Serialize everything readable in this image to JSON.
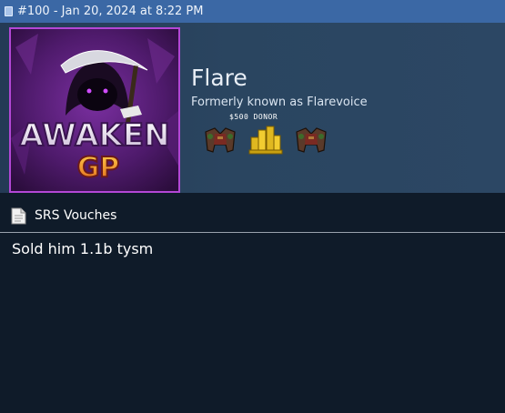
{
  "post": {
    "header": "#100 - Jan 20, 2024 at 8:22 PM"
  },
  "user": {
    "avatar_text_line1": "AWAKEN",
    "avatar_text_line2": "GP",
    "name": "Flare",
    "formerly": "Formerly known as Flarevoice",
    "donor_label": "$500 DONOR",
    "badges": [
      "goblin-mail-icon",
      "gold-coins-icon",
      "goblin-mail-icon"
    ]
  },
  "section": {
    "title": "SRS Vouches"
  },
  "message": {
    "text": "Sold him 1.1b tysm"
  },
  "colors": {
    "topbar": "#3b68a5",
    "profile_bg": "#2a4560",
    "page_bg": "#0f1b29",
    "avatar_border": "#b347d6"
  }
}
